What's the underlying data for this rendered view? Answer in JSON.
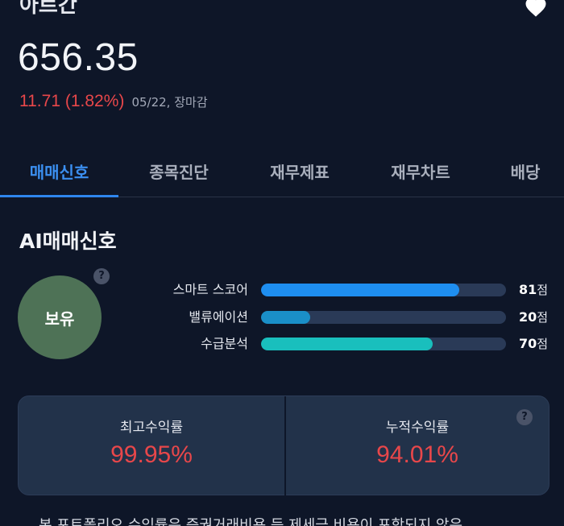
{
  "stock": {
    "name": "아르간",
    "price": "656.35",
    "change": "11.71 (1.82%)",
    "meta": "05/22, 장마감"
  },
  "tabs": [
    {
      "label": "매매신호",
      "active": true
    },
    {
      "label": "종목진단",
      "active": false
    },
    {
      "label": "재무제표",
      "active": false
    },
    {
      "label": "재무차트",
      "active": false
    },
    {
      "label": "배당",
      "active": false
    }
  ],
  "ai_signal": {
    "title": "AI매매신호",
    "signal": "보유",
    "help": "?",
    "scores": [
      {
        "label": "스마트 스코어",
        "value": "81",
        "unit": "점",
        "level": 81,
        "color": "#1e8ef0"
      },
      {
        "label": "밸류에이션",
        "value": "20",
        "unit": "점",
        "level": 20,
        "color": "#1a8fc8"
      },
      {
        "label": "수급분석",
        "value": "70",
        "unit": "점",
        "level": 70,
        "color": "#19bfbd"
      }
    ]
  },
  "returns": {
    "max_label": "최고수익률",
    "max_value": "99.95%",
    "cum_label": "누적수익률",
    "cum_value": "94.01%",
    "help": "?"
  },
  "disclaimer": "본 포트폴리오 수익률은 증권거래비용 등 제세금 비용이 포함되지 않은"
}
